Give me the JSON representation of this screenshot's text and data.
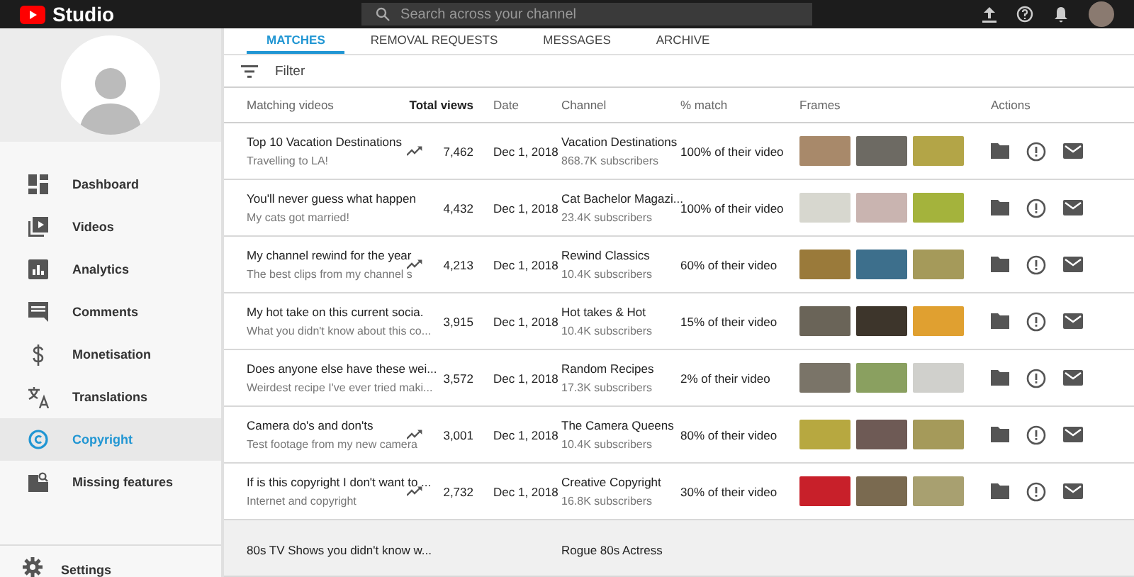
{
  "topbar": {
    "logo_text": "Studio",
    "search": {
      "placeholder": "Search across your channel"
    }
  },
  "sidebar": {
    "items": [
      {
        "label": "Dashboard",
        "selected": false
      },
      {
        "label": "Videos",
        "selected": false
      },
      {
        "label": "Analytics",
        "selected": false
      },
      {
        "label": "Comments",
        "selected": false
      },
      {
        "label": "Monetisation",
        "selected": false
      },
      {
        "label": "Translations",
        "selected": false
      },
      {
        "label": "Copyright",
        "selected": true
      },
      {
        "label": "Missing features",
        "selected": false
      }
    ],
    "footer": {
      "label": "Settings"
    }
  },
  "tabs": [
    {
      "label": "MATCHES",
      "selected": true
    },
    {
      "label": "REMOVAL REQUESTS",
      "selected": false
    },
    {
      "label": "MESSAGES",
      "selected": false
    },
    {
      "label": "ARCHIVE",
      "selected": false
    }
  ],
  "filter": {
    "label": "Filter"
  },
  "table": {
    "columns": [
      "Matching videos",
      "Total views",
      "Date",
      "Channel",
      "% match",
      "Frames",
      "Actions"
    ],
    "rows": [
      {
        "title": "Top 10 Vacation Destinations",
        "subtitle": "Travelling to LA!",
        "trending": true,
        "views": "7,462",
        "date": "Dec 1, 2018",
        "channel": "Vacation Destinations",
        "subscribers": "868.7K subscribers",
        "match": "100% of their video"
      },
      {
        "title": "You'll never guess what happen",
        "subtitle": "My cats got married!",
        "trending": false,
        "views": "4,432",
        "date": "Dec 1, 2018",
        "channel": "Cat Bachelor Magazi...",
        "subscribers": "23.4K subscribers",
        "match": "100% of their video"
      },
      {
        "title": "My channel rewind for the year",
        "subtitle": "The best clips from my channel s",
        "trending": true,
        "views": "4,213",
        "date": "Dec 1, 2018",
        "channel": "Rewind Classics",
        "subscribers": "10.4K subscribers",
        "match": "60% of their video"
      },
      {
        "title": "My hot take on this current socia.",
        "subtitle": "What you didn't know about this co...",
        "trending": false,
        "views": "3,915",
        "date": "Dec 1, 2018",
        "channel": "Hot takes & Hot",
        "subscribers": "10.4K subscribers",
        "match": "15% of their video"
      },
      {
        "title": "Does anyone else have these wei...",
        "subtitle": "Weirdest recipe I've ever tried maki...",
        "trending": false,
        "views": "3,572",
        "date": "Dec 1, 2018",
        "channel": "Random Recipes",
        "subscribers": "17.3K subscribers",
        "match": "2% of their video"
      },
      {
        "title": "Camera do's and don'ts",
        "subtitle": "Test footage from my new camera",
        "trending": true,
        "views": "3,001",
        "date": "Dec 1, 2018",
        "channel": "The Camera Queens",
        "subscribers": "10.4K subscribers",
        "match": "80% of their video"
      },
      {
        "title": "If is this copyright I don't want to ...",
        "subtitle": "Internet and copyright",
        "trending": true,
        "views": "2,732",
        "date": "Dec 1, 2018",
        "channel": "Creative Copyright",
        "subscribers": "16.8K subscribers",
        "match": "30% of their video"
      },
      {
        "title": "80s TV Shows you didn't know w...",
        "trending": false,
        "channel": "Rogue 80s Actress"
      }
    ]
  }
}
